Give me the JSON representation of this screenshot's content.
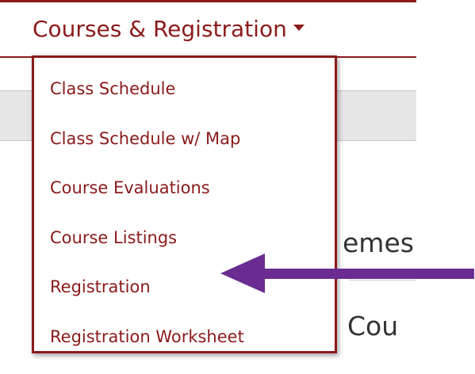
{
  "nav": {
    "menu_label": "Courses & Registration"
  },
  "dropdown": {
    "items": [
      {
        "label": "Class Schedule"
      },
      {
        "label": "Class Schedule w/ Map"
      },
      {
        "label": "Course Evaluations"
      },
      {
        "label": "Course Listings"
      },
      {
        "label": "Registration"
      },
      {
        "label": "Registration Worksheet"
      }
    ]
  },
  "background": {
    "partial_text_1": "emes",
    "partial_text_2": "Cou"
  },
  "colors": {
    "brand": "#8b1a1a",
    "arrow": "#6a2c91"
  }
}
